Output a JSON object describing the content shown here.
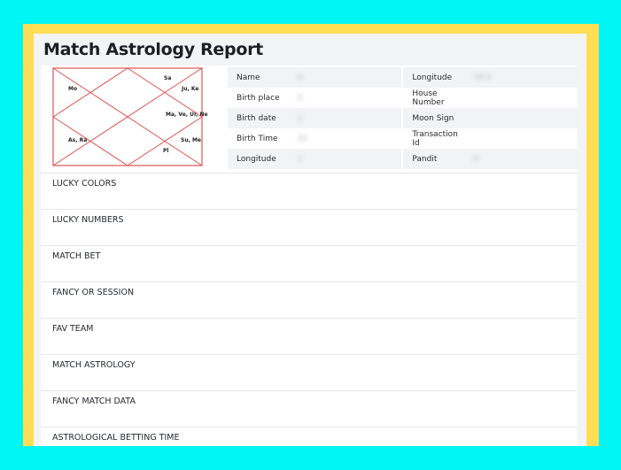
{
  "report": {
    "title": "Match Astrology Report"
  },
  "chart": {
    "houses": [
      {
        "id": "top-left-corner",
        "label": "Mo"
      },
      {
        "id": "top-right-a",
        "label": "Sa"
      },
      {
        "id": "top-right-b",
        "label": "Ju, Ke"
      },
      {
        "id": "right-center",
        "label": "Ma, Ve, Ur, Ne"
      },
      {
        "id": "left-lower",
        "label": "As, Ra"
      },
      {
        "id": "right-lower",
        "label": "Su, Me"
      },
      {
        "id": "bottom-right",
        "label": "Pl"
      }
    ],
    "line_color": "#e05353"
  },
  "details": {
    "rows": [
      {
        "left_label": "Name",
        "left_value": "A",
        "right_label": "Longitude",
        "right_value": "78.0"
      },
      {
        "left_label": "Birth place",
        "left_value": "S",
        "right_label": "House Number",
        "right_value": ""
      },
      {
        "left_label": "Birth date",
        "left_value": "1",
        "right_label": "Moon Sign",
        "right_value": ""
      },
      {
        "left_label": "Birth Time",
        "left_value": "20",
        "right_label": "Transaction Id",
        "right_value": ""
      },
      {
        "left_label": "Longitude",
        "left_value": "2",
        "right_label": "Pandit",
        "right_value": "A"
      }
    ]
  },
  "sections": [
    {
      "title": "LUCKY COLORS",
      "value": ""
    },
    {
      "title": "LUCKY NUMBERS",
      "value": ""
    },
    {
      "title": "MATCH BET",
      "value": ""
    },
    {
      "title": "FANCY OR SESSION",
      "value": ""
    },
    {
      "title": "FAV TEAM",
      "value": ""
    },
    {
      "title": "MATCH ASTROLOGY",
      "value": ""
    },
    {
      "title": "FANCY MATCH DATA",
      "value": ""
    },
    {
      "title": "ASTROLOGICAL BETTING TIME",
      "value": ""
    }
  ]
}
